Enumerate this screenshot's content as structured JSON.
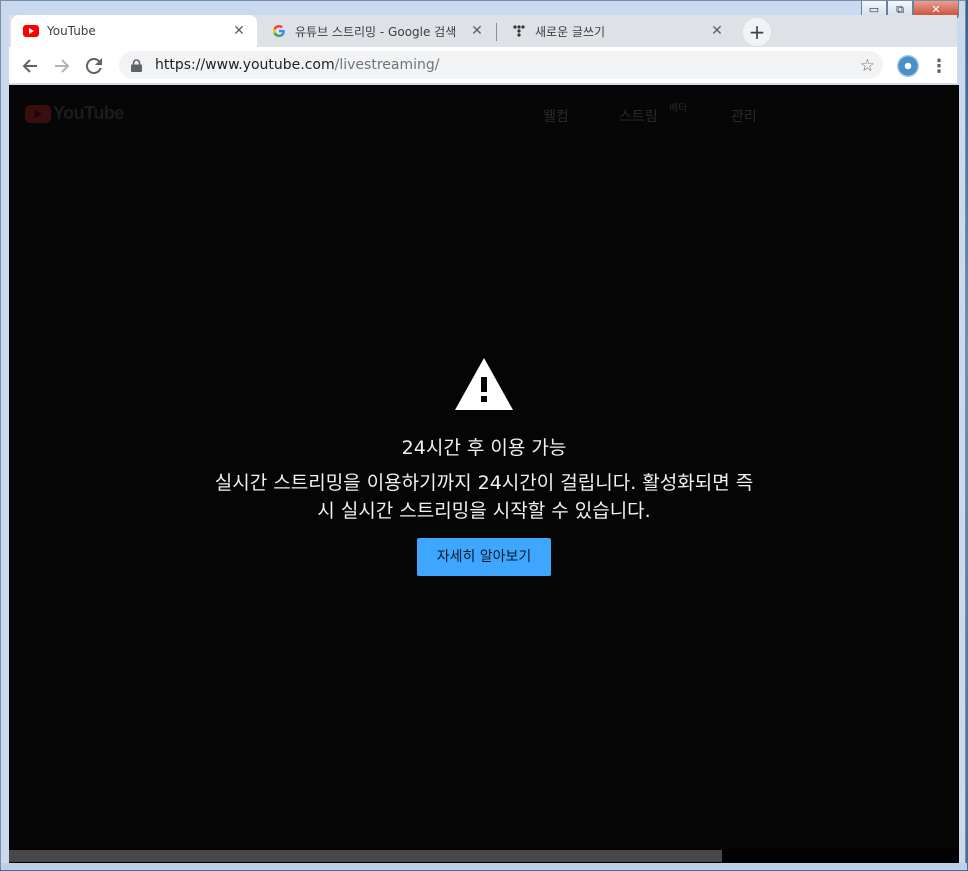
{
  "browser": {
    "tabs": [
      {
        "title": "YouTube",
        "active": true,
        "icon": "youtube-icon"
      },
      {
        "title": "유튜브 스트리밍 - Google 검색",
        "active": false,
        "icon": "google-icon"
      },
      {
        "title": "새로운 글쓰기",
        "active": false,
        "icon": "tistory-icon"
      }
    ],
    "new_tab": "+",
    "close_glyph": "✕",
    "url_host": "https://www.youtube.com",
    "url_path": "/livestreaming/",
    "window_controls": [
      "minimize",
      "maximize",
      "close"
    ]
  },
  "header": {
    "logo_text": "YouTube",
    "nav": [
      {
        "label": "웰컴"
      },
      {
        "label": "스트림",
        "badge": "베타"
      },
      {
        "label": "관리"
      }
    ]
  },
  "notice": {
    "title": "24시간 후 이용 가능",
    "message": "실시간 스트리밍을 이용하기까지 24시간이 걸립니다. 활성화되면 즉시 실시간 스트리밍을 시작할 수 있습니다.",
    "button_label": "자세히 알아보기"
  },
  "colors": {
    "accent": "#3ea6ff",
    "page_bg": "#050505"
  }
}
